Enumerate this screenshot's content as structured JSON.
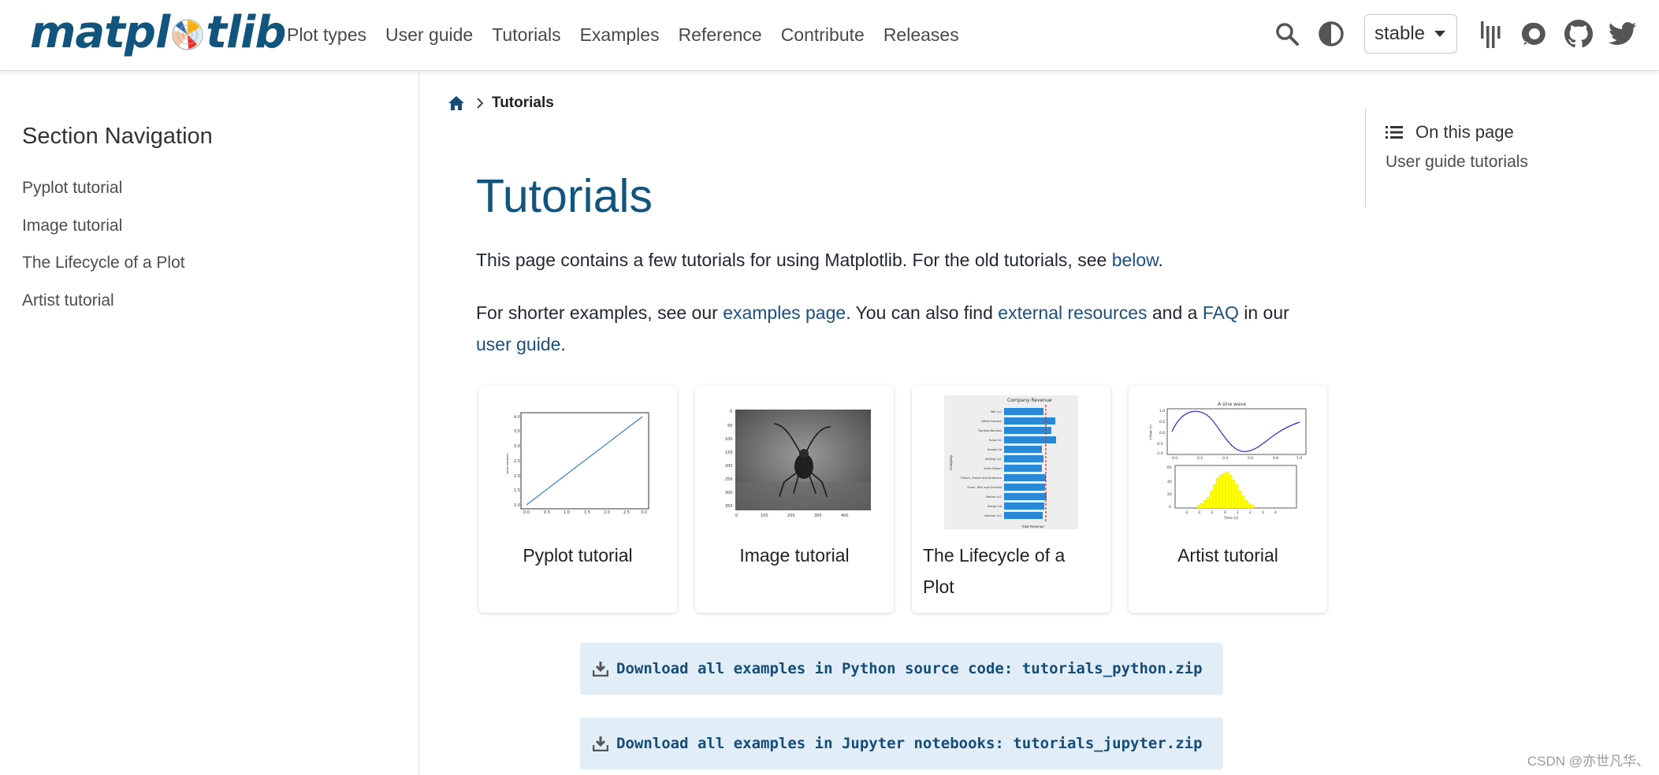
{
  "header": {
    "logo_left": "matpl",
    "logo_right": "tlib",
    "nav": [
      "Plot types",
      "User guide",
      "Tutorials",
      "Examples",
      "Reference",
      "Contribute",
      "Releases"
    ],
    "version": "stable",
    "icons": [
      "search-icon",
      "theme-toggle-icon",
      "gitter-icon",
      "discourse-icon",
      "github-icon",
      "twitter-icon"
    ]
  },
  "sidebar": {
    "title": "Section Navigation",
    "items": [
      "Pyplot tutorial",
      "Image tutorial",
      "The Lifecycle of a Plot",
      "Artist tutorial"
    ]
  },
  "breadcrumb": {
    "current": "Tutorials"
  },
  "main": {
    "title": "Tutorials",
    "p1": {
      "text": "This page contains a few tutorials for using Matplotlib. For the old tutorials, see ",
      "link": "below",
      "end": "."
    },
    "p2": {
      "t1": "For shorter examples, see our ",
      "l1": "examples page",
      "t2": ". You can also find ",
      "l2": "external resources",
      "t3": " and a ",
      "l3": "FAQ",
      "t4": " in our ",
      "l4": "user guide",
      "t5": "."
    },
    "cards": [
      {
        "caption": "Pyplot tutorial"
      },
      {
        "caption": "Image tutorial"
      },
      {
        "caption": "The Lifecycle of a Plot"
      },
      {
        "caption": "Artist tutorial"
      }
    ],
    "downloads": [
      "Download all examples in Python source code: tutorials_python.zip",
      "Download all examples in Jupyter notebooks: tutorials_jupyter.zip"
    ]
  },
  "toc": {
    "heading": "On this page",
    "items": [
      "User guide tutorials"
    ]
  },
  "watermark": "CSDN @亦世凡华、",
  "colors": {
    "brand": "#11557c",
    "link": "#1b4f80",
    "download_bg": "#e1eef7"
  }
}
